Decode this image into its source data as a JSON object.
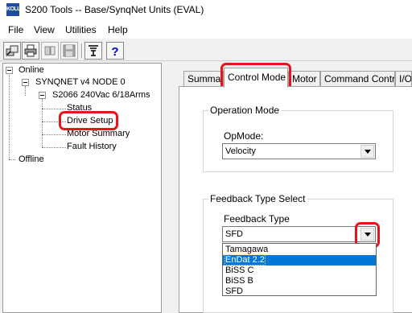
{
  "window": {
    "title": "S200 Tools -- Base/SynqNet Units (EVAL)",
    "app_icon_text": "KOLL"
  },
  "menu": [
    "File",
    "View",
    "Utilities",
    "Help"
  ],
  "toolbar": {
    "buttons": [
      "connect-icon",
      "print-icon",
      "disconnect-icon",
      "save-icon",
      "filter-icon",
      "help-icon"
    ],
    "help_glyph": "?"
  },
  "tree": {
    "online": "Online",
    "synqnet": "SYNQNET v4 NODE 0",
    "drive": "S2066 240Vac 6/18Arms",
    "status": "Status",
    "drive_setup": "Drive Setup",
    "motor_summary": "Motor Summary",
    "fault_history": "Fault History",
    "offline": "Offline"
  },
  "tabs": [
    "Summary",
    "Control Mode",
    "Motor",
    "Command Control",
    "I/O"
  ],
  "active_tab": "Control Mode",
  "operation_mode": {
    "group_label": "Operation Mode",
    "opmode_label": "OpMode:",
    "opmode_value": "Velocity"
  },
  "feedback": {
    "group_label": "Feedback Type Select",
    "type_label": "Feedback Type",
    "type_value": "SFD",
    "options": [
      "Tamagawa",
      "EnDat 2.2",
      "BiSS C",
      "BiSS B",
      "SFD"
    ],
    "highlighted_option": "EnDat 2.2"
  },
  "colors": {
    "annotation": "#e8141c",
    "selection": "#0078d7",
    "app_icon": "#1e4f9c"
  }
}
